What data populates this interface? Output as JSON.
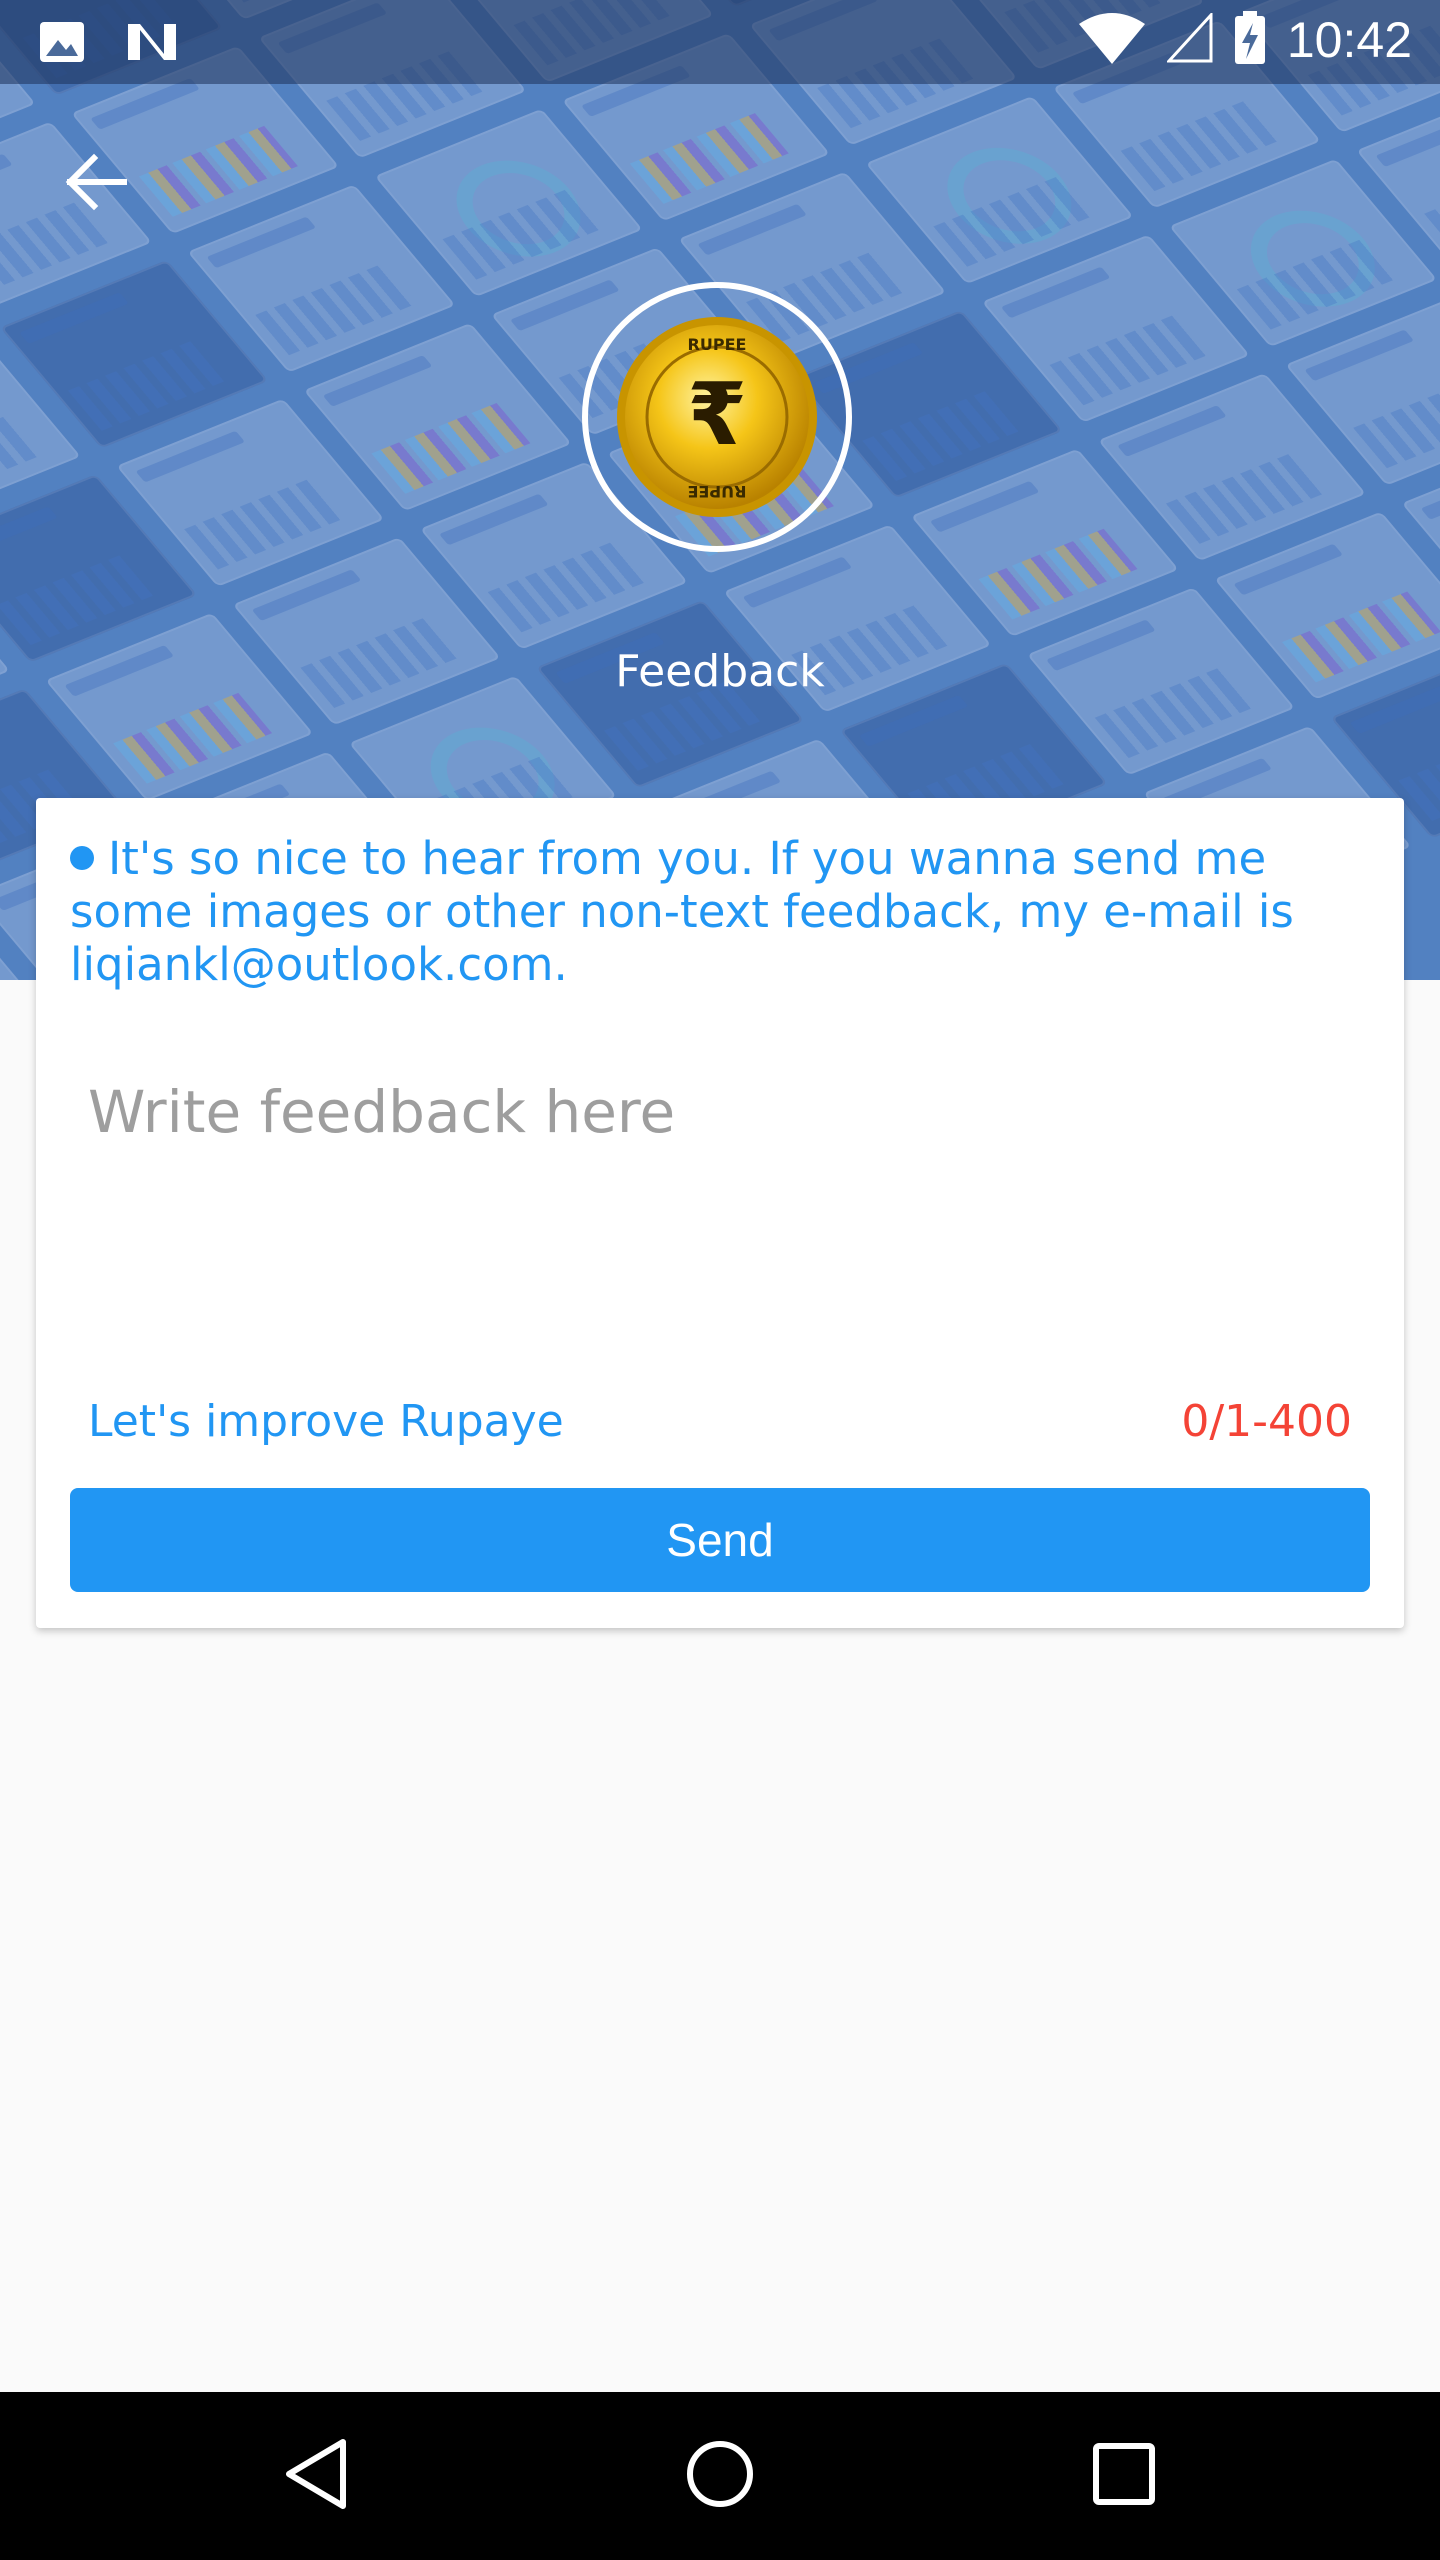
{
  "status_bar": {
    "time": "10:42",
    "icons": [
      "image-icon",
      "n-notification-icon",
      "wifi-icon",
      "signal-icon",
      "battery-charging-icon"
    ]
  },
  "toolbar": {
    "back_icon": "arrow-back-icon",
    "title": "Feedback",
    "logo": "rupee-coin-logo",
    "logo_text_top": "RUPEE",
    "logo_text_bottom": "RUPEE",
    "logo_symbol": "₹"
  },
  "card": {
    "notice": "It's so nice to hear from you. If you wanna send me some images or other non-text feedback, my e-mail is liqiankl@outlook.com.",
    "input": {
      "placeholder": "Write feedback here",
      "value": ""
    },
    "improve_label": "Let's improve Rupaye",
    "char_counter": "0/1-400",
    "send_label": "Send"
  },
  "nav_bar": {
    "back": "nav-back-icon",
    "home": "nav-home-icon",
    "recents": "nav-recents-icon"
  },
  "colors": {
    "accent": "#2196f3",
    "counter": "#f44336",
    "background": "#fafafa",
    "header": "#5f8cc4"
  }
}
